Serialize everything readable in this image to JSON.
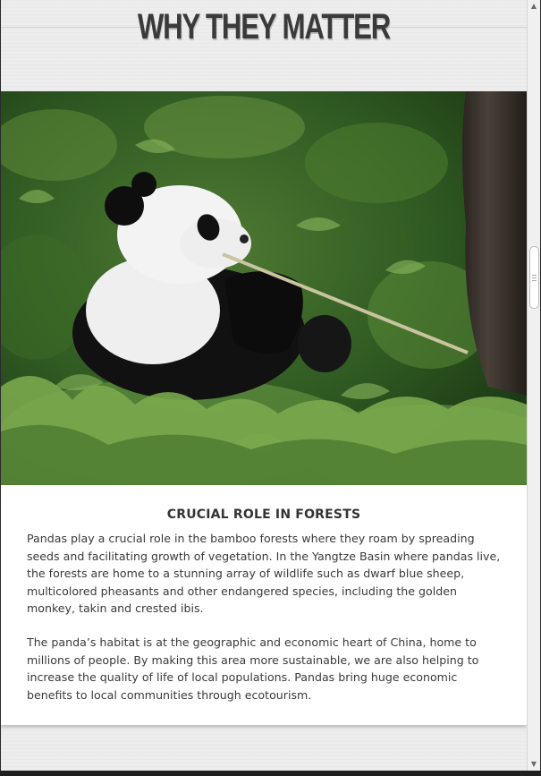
{
  "section": {
    "title": "WHY THEY MATTER"
  },
  "hero": {
    "alt": "Giant panda eating bamboo in a forest"
  },
  "card": {
    "title": "CRUCIAL ROLE IN FORESTS",
    "paragraphs": [
      "Pandas play a crucial role in the bamboo forests where they roam by spreading seeds and facilitating growth of vegetation. In the Yangtze Basin where pandas live, the forests are home to a stunning array of wildlife such as dwarf blue sheep, multicolored pheasants and other endangered species, including the golden monkey, takin and crested ibis.",
      "The panda’s habitat is at the geographic and economic heart of China, home to millions of people. By making this area more sustainable, we are also helping to increase the quality of life of local populations. Pandas bring huge economic benefits to local communities through ecotourism."
    ]
  },
  "scrollbar": {
    "up_icon": "triangle-up-icon",
    "down_icon": "triangle-down-icon"
  }
}
